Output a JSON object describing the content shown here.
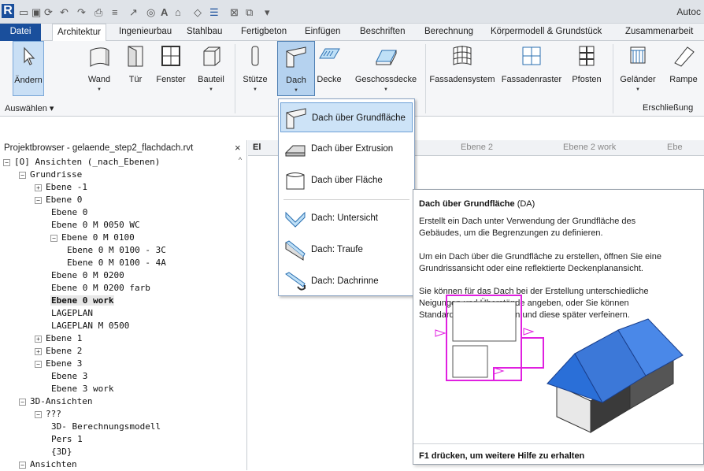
{
  "app": {
    "title": "Autoc",
    "qat_icons": [
      "revit-logo",
      "open-icon",
      "save-icon",
      "sync-icon",
      "undo-icon",
      "redo-icon",
      "print-icon",
      "measure-icon",
      "dimension-icon",
      "tag-icon",
      "text-icon",
      "3d-view-icon",
      "section-icon",
      "thin-lines-icon",
      "close-hidden-icon",
      "switch-windows-icon",
      "customize-icon"
    ]
  },
  "tabs": [
    "Datei",
    "Architektur",
    "Ingenieurbau",
    "Stahlbau",
    "Fertigbeton",
    "Einfügen",
    "Beschriften",
    "Berechnung",
    "Körpermodell & Grundstück",
    "Zusammenarbeit"
  ],
  "ribbon": {
    "tools": [
      {
        "label": "Ändern",
        "icon": "cursor-arrow-icon",
        "dropdown": false
      },
      {
        "label": "Wand",
        "icon": "wall-icon",
        "dropdown": true
      },
      {
        "label": "Tür",
        "icon": "door-icon",
        "dropdown": false
      },
      {
        "label": "Fenster",
        "icon": "window-icon",
        "dropdown": false
      },
      {
        "label": "Bauteil",
        "icon": "component-icon",
        "dropdown": true
      },
      {
        "label": "Stütze",
        "icon": "column-icon",
        "dropdown": true
      },
      {
        "label": "Dach",
        "icon": "roof-icon",
        "dropdown": true
      },
      {
        "label": "Decke",
        "icon": "ceiling-icon",
        "dropdown": false
      },
      {
        "label": "Geschossdecke",
        "icon": "floor-icon",
        "dropdown": true
      },
      {
        "label": "Fassadensystem",
        "icon": "curtain-system-icon",
        "dropdown": false
      },
      {
        "label": "Fassadenraster",
        "icon": "curtain-grid-icon",
        "dropdown": false
      },
      {
        "label": "Pfosten",
        "icon": "mullion-icon",
        "dropdown": false
      },
      {
        "label": "Geländer",
        "icon": "railing-icon",
        "dropdown": true
      },
      {
        "label": "Rampe",
        "icon": "ramp-icon",
        "dropdown": false
      }
    ],
    "select_label": "Auswählen ▾",
    "group_label": "Erschließung"
  },
  "browser": {
    "title": "Projektbrowser - gelaende_step2_flachdach.rvt",
    "close": "×",
    "items": [
      {
        "text": "[O] Ansichten (_nach_Ebenen)",
        "exp": "⊟"
      },
      {
        "text": "Grundrisse",
        "exp": "⊟"
      },
      {
        "text": "Ebene -1",
        "exp": "⊞"
      },
      {
        "text": "Ebene 0",
        "exp": "⊟"
      },
      {
        "text": "Ebene 0",
        "exp": ""
      },
      {
        "text": "Ebene 0 M 0050 WC",
        "exp": ""
      },
      {
        "text": "Ebene 0 M 0100",
        "exp": "⊟"
      },
      {
        "text": "Ebene 0 M 0100 - 3C",
        "exp": ""
      },
      {
        "text": "Ebene 0 M 0100 - 4A",
        "exp": ""
      },
      {
        "text": "Ebene 0 M 0200",
        "exp": ""
      },
      {
        "text": "Ebene 0 M 0200 farb",
        "exp": ""
      },
      {
        "text": "Ebene 0 work",
        "exp": "",
        "bold": true
      },
      {
        "text": "LAGEPLAN",
        "exp": ""
      },
      {
        "text": "LAGEPLAN M 0500",
        "exp": ""
      },
      {
        "text": "Ebene 1",
        "exp": "⊞"
      },
      {
        "text": "Ebene 2",
        "exp": "⊞"
      },
      {
        "text": "Ebene 3",
        "exp": "⊟"
      },
      {
        "text": "Ebene 3",
        "exp": ""
      },
      {
        "text": "Ebene 3 work",
        "exp": ""
      },
      {
        "text": "3D-Ansichten",
        "exp": "⊟"
      },
      {
        "text": "???",
        "exp": "⊟"
      },
      {
        "text": "3D- Berechnungsmodell",
        "exp": ""
      },
      {
        "text": "Pers 1",
        "exp": ""
      },
      {
        "text": "{3D}",
        "exp": ""
      },
      {
        "text": "Ansichten",
        "exp": "⊟"
      }
    ]
  },
  "view_tabs": [
    "El",
    "Ebene 2",
    "Ebene 2 work",
    "Ebe"
  ],
  "roof_menu": [
    {
      "label": "Dach über Grundfläche",
      "icon": "roof-by-footprint-icon",
      "highlighted": true
    },
    {
      "label": "Dach über Extrusion",
      "icon": "roof-by-extrusion-icon"
    },
    {
      "label": "Dach über Fläche",
      "icon": "roof-by-face-icon"
    },
    {
      "label": "Dach: Untersicht",
      "icon": "roof-soffit-icon"
    },
    {
      "label": "Dach: Traufe",
      "icon": "roof-fascia-icon"
    },
    {
      "label": "Dach: Dachrinne",
      "icon": "roof-gutter-icon"
    }
  ],
  "tooltip": {
    "title": "Dach über Grundfläche",
    "shortcut": "(DA)",
    "paragraphs": [
      "Erstellt ein Dach unter Verwendung der Grundfläche des Gebäudes, um die Begrenzungen zu definieren.",
      "Um ein Dach über die Grundfläche zu erstellen, öffnen Sie eine Grundrissansicht oder eine reflektierte Deckenplanansicht.",
      "Sie können für das Dach bei der Erstellung unterschiedliche Neigungen und Überstände angeben, oder Sie können Standardwerte verwenden und diese später verfeinern."
    ],
    "help": "F1 drücken, um weitere Hilfe zu erhalten"
  },
  "colors": {
    "accent": "#1a4f9c",
    "highlight": "#cde3f7",
    "footprint": "#e020e0",
    "roof": "#3c78d8"
  }
}
